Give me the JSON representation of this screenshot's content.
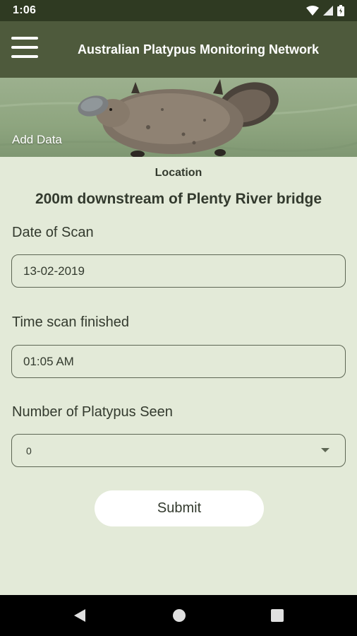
{
  "status_bar": {
    "time": "1:06",
    "icons": [
      "wifi-icon",
      "signal-icon",
      "battery-icon"
    ]
  },
  "app_bar": {
    "title": "Australian Platypus Monitoring Network",
    "menu_icon": "hamburger-menu-icon"
  },
  "hero": {
    "label": "Add Data"
  },
  "form": {
    "location_label": "Location",
    "location_value": "200m downstream of Plenty River bridge",
    "date_label": "Date of Scan",
    "date_value": "13-02-2019",
    "time_label": "Time scan finished",
    "time_value": "01:05 AM",
    "count_label": "Number of Platypus Seen",
    "count_value": "0",
    "submit_label": "Submit"
  },
  "nav_bar": {
    "icons": [
      "back-icon",
      "home-icon",
      "recents-icon"
    ]
  },
  "colors": {
    "status_bar": "#2f3a22",
    "app_bar": "#4e5a3c",
    "background": "#e3ead8",
    "text": "#333a2e",
    "submit_bg": "#ffffff"
  }
}
